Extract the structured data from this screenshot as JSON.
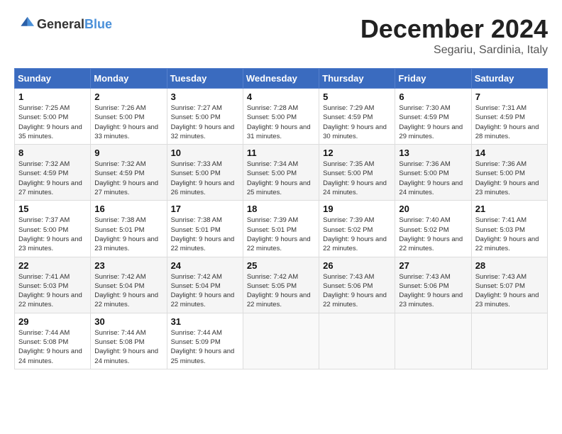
{
  "header": {
    "logo": {
      "general": "General",
      "blue": "Blue"
    },
    "title": "December 2024",
    "location": "Segariu, Sardinia, Italy"
  },
  "calendar": {
    "weekdays": [
      "Sunday",
      "Monday",
      "Tuesday",
      "Wednesday",
      "Thursday",
      "Friday",
      "Saturday"
    ],
    "weeks": [
      [
        null,
        {
          "day": "2",
          "sunrise": "7:26 AM",
          "sunset": "5:00 PM",
          "daylight": "9 hours and 33 minutes."
        },
        {
          "day": "3",
          "sunrise": "7:27 AM",
          "sunset": "5:00 PM",
          "daylight": "9 hours and 32 minutes."
        },
        {
          "day": "4",
          "sunrise": "7:28 AM",
          "sunset": "5:00 PM",
          "daylight": "9 hours and 31 minutes."
        },
        {
          "day": "5",
          "sunrise": "7:29 AM",
          "sunset": "4:59 PM",
          "daylight": "9 hours and 30 minutes."
        },
        {
          "day": "6",
          "sunrise": "7:30 AM",
          "sunset": "4:59 PM",
          "daylight": "9 hours and 29 minutes."
        },
        {
          "day": "7",
          "sunrise": "7:31 AM",
          "sunset": "4:59 PM",
          "daylight": "9 hours and 28 minutes."
        }
      ],
      [
        {
          "day": "1",
          "sunrise": "7:25 AM",
          "sunset": "5:00 PM",
          "daylight": "9 hours and 35 minutes."
        },
        {
          "day": "9",
          "sunrise": "7:32 AM",
          "sunset": "4:59 PM",
          "daylight": "9 hours and 27 minutes."
        },
        {
          "day": "10",
          "sunrise": "7:33 AM",
          "sunset": "5:00 PM",
          "daylight": "9 hours and 26 minutes."
        },
        {
          "day": "11",
          "sunrise": "7:34 AM",
          "sunset": "5:00 PM",
          "daylight": "9 hours and 25 minutes."
        },
        {
          "day": "12",
          "sunrise": "7:35 AM",
          "sunset": "5:00 PM",
          "daylight": "9 hours and 24 minutes."
        },
        {
          "day": "13",
          "sunrise": "7:36 AM",
          "sunset": "5:00 PM",
          "daylight": "9 hours and 24 minutes."
        },
        {
          "day": "14",
          "sunrise": "7:36 AM",
          "sunset": "5:00 PM",
          "daylight": "9 hours and 23 minutes."
        }
      ],
      [
        {
          "day": "8",
          "sunrise": "7:32 AM",
          "sunset": "4:59 PM",
          "daylight": "9 hours and 27 minutes."
        },
        {
          "day": "16",
          "sunrise": "7:38 AM",
          "sunset": "5:01 PM",
          "daylight": "9 hours and 23 minutes."
        },
        {
          "day": "17",
          "sunrise": "7:38 AM",
          "sunset": "5:01 PM",
          "daylight": "9 hours and 22 minutes."
        },
        {
          "day": "18",
          "sunrise": "7:39 AM",
          "sunset": "5:01 PM",
          "daylight": "9 hours and 22 minutes."
        },
        {
          "day": "19",
          "sunrise": "7:39 AM",
          "sunset": "5:02 PM",
          "daylight": "9 hours and 22 minutes."
        },
        {
          "day": "20",
          "sunrise": "7:40 AM",
          "sunset": "5:02 PM",
          "daylight": "9 hours and 22 minutes."
        },
        {
          "day": "21",
          "sunrise": "7:41 AM",
          "sunset": "5:03 PM",
          "daylight": "9 hours and 22 minutes."
        }
      ],
      [
        {
          "day": "15",
          "sunrise": "7:37 AM",
          "sunset": "5:00 PM",
          "daylight": "9 hours and 23 minutes."
        },
        {
          "day": "23",
          "sunrise": "7:42 AM",
          "sunset": "5:04 PM",
          "daylight": "9 hours and 22 minutes."
        },
        {
          "day": "24",
          "sunrise": "7:42 AM",
          "sunset": "5:04 PM",
          "daylight": "9 hours and 22 minutes."
        },
        {
          "day": "25",
          "sunrise": "7:42 AM",
          "sunset": "5:05 PM",
          "daylight": "9 hours and 22 minutes."
        },
        {
          "day": "26",
          "sunrise": "7:43 AM",
          "sunset": "5:06 PM",
          "daylight": "9 hours and 22 minutes."
        },
        {
          "day": "27",
          "sunrise": "7:43 AM",
          "sunset": "5:06 PM",
          "daylight": "9 hours and 23 minutes."
        },
        {
          "day": "28",
          "sunrise": "7:43 AM",
          "sunset": "5:07 PM",
          "daylight": "9 hours and 23 minutes."
        }
      ],
      [
        {
          "day": "22",
          "sunrise": "7:41 AM",
          "sunset": "5:03 PM",
          "daylight": "9 hours and 22 minutes."
        },
        {
          "day": "30",
          "sunrise": "7:44 AM",
          "sunset": "5:08 PM",
          "daylight": "9 hours and 24 minutes."
        },
        {
          "day": "31",
          "sunrise": "7:44 AM",
          "sunset": "5:09 PM",
          "daylight": "9 hours and 25 minutes."
        },
        null,
        null,
        null,
        null
      ],
      [
        {
          "day": "29",
          "sunrise": "7:44 AM",
          "sunset": "5:08 PM",
          "daylight": "9 hours and 24 minutes."
        },
        null,
        null,
        null,
        null,
        null,
        null
      ]
    ]
  }
}
